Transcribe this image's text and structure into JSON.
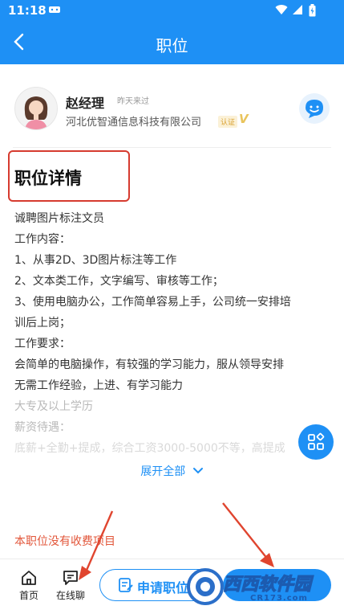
{
  "status_bar": {
    "time": "11:18"
  },
  "nav": {
    "title": "职位"
  },
  "recruiter": {
    "name": "赵经理",
    "last_seen": "昨天来过",
    "company": "河北优智通信息科技有限公司",
    "verified_label": "认证"
  },
  "section": {
    "title": "职位详情"
  },
  "description": [
    "诚聘图片标注文员",
    "工作内容：",
    "1、从事2D、3D图片标注等工作",
    "2、文本类工作，文字编写、审核等工作；",
    "3、使用电脑办公，工作简单容易上手，公司统一安排培",
    "训后上岗；",
    "工作要求：",
    "会简单的电脑操作，有较强的学习能力，服从领导安排",
    "无需工作经验，上进、有学习能力",
    "大专及以上学历",
    "薪资待遇：",
    "底薪+全勤+提成，综合工资3000-5000不等，高提成"
  ],
  "expand_label": "展开全部",
  "notice": "本职位没有收费项目",
  "bottom_bar": {
    "home_label": "首页",
    "chat_label": "在线聊",
    "apply_label": "申请职位"
  },
  "watermark": {
    "text": "西西软件园",
    "url": "CR173.com"
  },
  "colors": {
    "primary": "#1e90f5",
    "notice": "#e2563a",
    "annotation_red": "#d63b2f"
  }
}
